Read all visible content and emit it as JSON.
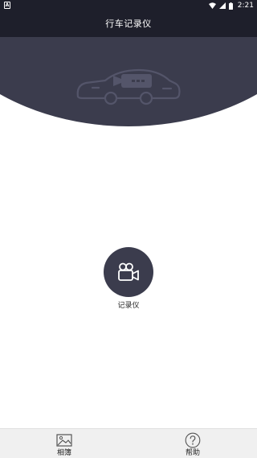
{
  "status_bar": {
    "left_icon": "A",
    "time": "2:21",
    "icons": [
      "wifi-icon",
      "signal-icon",
      "battery-icon"
    ]
  },
  "header": {
    "title": "行车记录仪"
  },
  "hero": {
    "illustration": "car-camera-icon"
  },
  "main": {
    "record_label": "记录仪",
    "record_icon": "video-camera-icon"
  },
  "bottom_nav": {
    "items": [
      {
        "label": "相簿",
        "icon": "image-icon"
      },
      {
        "label": "帮助",
        "icon": "help-icon"
      }
    ]
  },
  "colors": {
    "header_bg": "#1e1f2b",
    "hero_bg": "#3b3c4d",
    "nav_bg": "#f0f0f0"
  }
}
